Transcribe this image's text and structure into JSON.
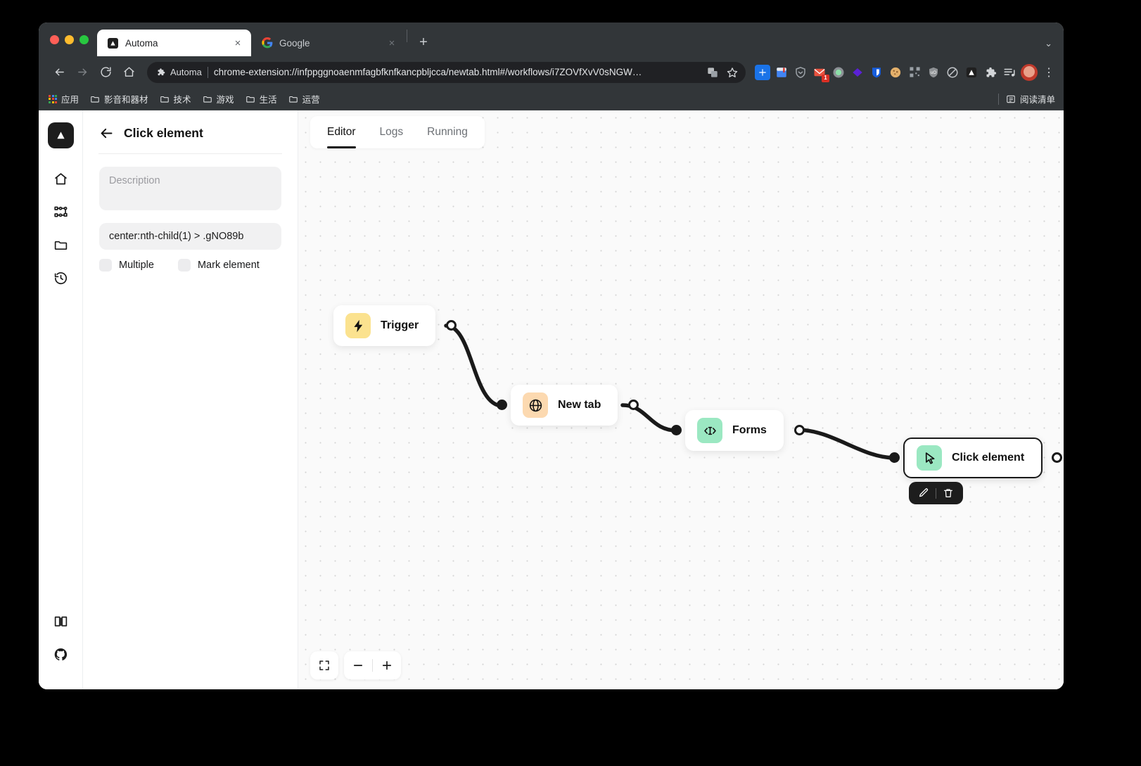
{
  "browser": {
    "tabs": [
      {
        "title": "Automa",
        "favicon": "automa-icon",
        "active": true,
        "close_label": "×"
      },
      {
        "title": "Google",
        "favicon": "google-icon",
        "active": false,
        "close_label": "×"
      }
    ],
    "new_tab_label": "+",
    "window_caret": "⌄",
    "omnibox": {
      "extension_name": "Automa",
      "url": "chrome-extension://infppggnoaenmfagbfknfkancpbljcca/newtab.html#/workflows/i7ZOVfXvV0sNGW…",
      "translate_icon": "translate-icon",
      "bookmark_icon": "star-icon"
    },
    "nav": {
      "back": "←",
      "forward": "→",
      "reload": "⟳",
      "home": "⌂"
    },
    "extensions": [
      {
        "name": "add-extension-icon",
        "color": "#1a73e8"
      },
      {
        "name": "notebook-extension-icon",
        "color": "#4285f4"
      },
      {
        "name": "shield-check-extension-icon",
        "color": "#8e9194"
      },
      {
        "name": "mail-extension-icon",
        "color": "#e8523f",
        "badge": "1"
      },
      {
        "name": "circle-green-extension-icon",
        "color": "#8d9196"
      },
      {
        "name": "diamond-extension-icon",
        "color": "#5b21d6"
      },
      {
        "name": "bitwarden-extension-icon",
        "color": "#175ddc"
      },
      {
        "name": "cookie-extension-icon",
        "color": "#e3b06b"
      },
      {
        "name": "qrcode-extension-icon",
        "color": "#9aa0a6"
      },
      {
        "name": "ublock-extension-icon",
        "color": "#8e9194"
      },
      {
        "name": "block-extension-icon",
        "color": "#b9bcc0"
      },
      {
        "name": "automa-extension-icon",
        "color": "#1f1f1f"
      },
      {
        "name": "puzzle-extensions-icon",
        "color": "#d2d5d8"
      },
      {
        "name": "playlist-extension-icon",
        "color": "#d2d5d8"
      }
    ],
    "profile_icon": "avatar",
    "menu_icon": "three-dots-icon",
    "bookmarks": [
      {
        "label": "应用",
        "icon": "apps-grid-icon"
      },
      {
        "label": "影音和器材",
        "icon": "folder-icon"
      },
      {
        "label": "技术",
        "icon": "folder-icon"
      },
      {
        "label": "游戏",
        "icon": "folder-icon"
      },
      {
        "label": "生活",
        "icon": "folder-icon"
      },
      {
        "label": "运营",
        "icon": "folder-icon"
      }
    ],
    "reading_list": {
      "label": "阅读清单",
      "icon": "reading-list-icon"
    }
  },
  "rail": {
    "logo": "automa-logo",
    "items": [
      {
        "name": "home",
        "icon": "home-icon"
      },
      {
        "name": "workflows",
        "icon": "sitemap-icon"
      },
      {
        "name": "folders",
        "icon": "folder-icon"
      },
      {
        "name": "history",
        "icon": "history-icon"
      }
    ],
    "bottom_items": [
      {
        "name": "docs",
        "icon": "book-icon"
      },
      {
        "name": "github",
        "icon": "github-icon"
      }
    ]
  },
  "panel": {
    "back_icon": "arrow-left-icon",
    "title": "Click element",
    "description_placeholder": "Description",
    "selector_value": "center:nth-child(1) > .gNO89b",
    "checkboxes": [
      {
        "label": "Multiple",
        "checked": false
      },
      {
        "label": "Mark element",
        "checked": false
      }
    ]
  },
  "editor": {
    "tabs": [
      {
        "label": "Editor",
        "active": true
      },
      {
        "label": "Logs",
        "active": false
      },
      {
        "label": "Running",
        "active": false
      }
    ],
    "nodes": [
      {
        "label": "Trigger",
        "icon": "lightning-icon",
        "icon_bg": "#fbe28f",
        "selected": false
      },
      {
        "label": "New tab",
        "icon": "globe-icon",
        "icon_bg": "#fcd9b0",
        "selected": false
      },
      {
        "label": "Forms",
        "icon": "form-code-icon",
        "icon_bg": "#9be8c2",
        "selected": false
      },
      {
        "label": "Click element",
        "icon": "cursor-icon",
        "icon_bg": "#9be8c2",
        "selected": true
      }
    ],
    "node_toolbar": [
      {
        "name": "edit",
        "icon": "pencil-icon"
      },
      {
        "name": "delete",
        "icon": "trash-icon"
      }
    ],
    "zoom_controls": [
      {
        "name": "fit-view",
        "icon": "expand-icon"
      },
      {
        "name": "zoom-out",
        "icon": "minus-icon"
      },
      {
        "name": "zoom-in",
        "icon": "plus-icon"
      }
    ]
  }
}
